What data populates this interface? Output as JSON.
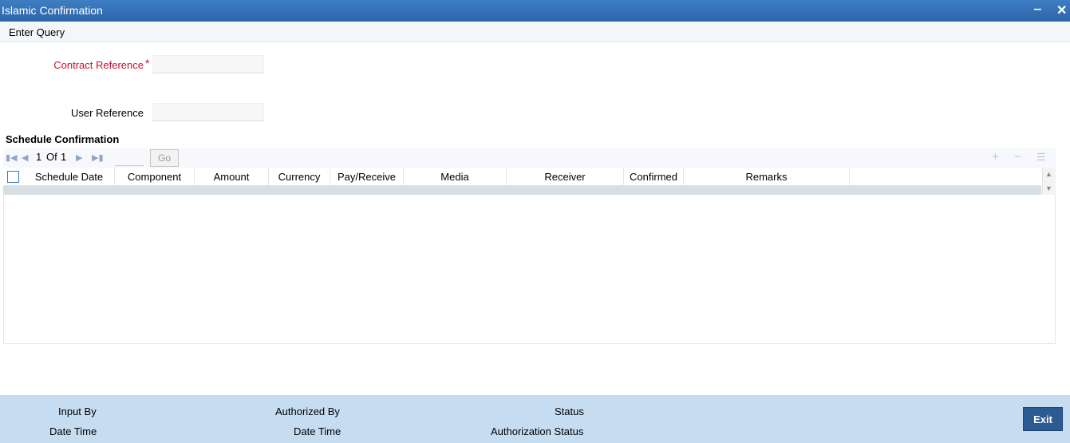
{
  "window": {
    "title": "Islamic Confirmation",
    "minimize_label": "‒",
    "close_label": "✕"
  },
  "menu": {
    "enter_query": "Enter Query"
  },
  "form": {
    "contract_reference_label": "Contract Reference",
    "required_marker": "*",
    "contract_reference_value": "",
    "user_reference_label": "User Reference",
    "user_reference_value": ""
  },
  "section": {
    "title": "Schedule Confirmation"
  },
  "pager": {
    "current": "1",
    "of_label": "Of",
    "total": "1",
    "go_label": "Go"
  },
  "grid": {
    "columns": [
      "Schedule Date",
      "Component",
      "Amount",
      "Currency",
      "Pay/Receive",
      "Media",
      "Receiver",
      "Confirmed",
      "Remarks"
    ],
    "rows": []
  },
  "footer": {
    "input_by": "Input By",
    "date_time_1": "Date Time",
    "authorized_by": "Authorized By",
    "date_time_2": "Date Time",
    "status": "Status",
    "authorization_status": "Authorization Status",
    "exit_label": "Exit"
  },
  "colors": {
    "title_bar": "#2d64a8",
    "footer_bg": "#c6dcf1",
    "exit_button": "#2c5a92",
    "required": "#c8102e"
  }
}
